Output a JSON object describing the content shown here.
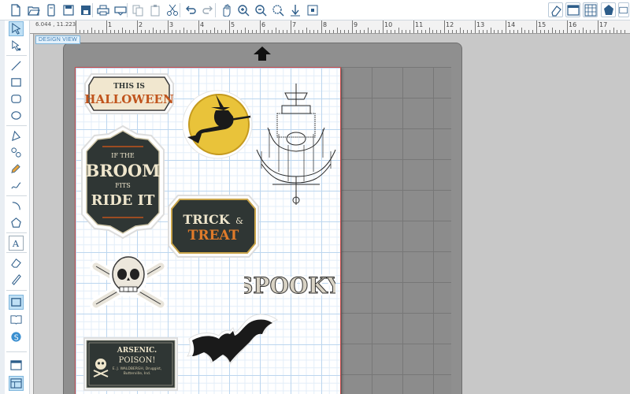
{
  "toolbar": {
    "buttons": [
      {
        "name": "new-document-icon",
        "glyph": "□"
      },
      {
        "name": "open-folder-icon",
        "glyph": "▭"
      },
      {
        "name": "library-icon",
        "glyph": "▯"
      },
      {
        "name": "save-icon",
        "glyph": "▣"
      },
      {
        "name": "save-as-icon",
        "glyph": "▤"
      },
      {
        "name": "print-icon",
        "glyph": "⎙"
      },
      {
        "name": "send-to-cutter-icon",
        "glyph": "⇥"
      },
      {
        "name": "copy-icon",
        "glyph": "❐"
      },
      {
        "name": "paste-icon",
        "glyph": "❏"
      },
      {
        "name": "cut-icon",
        "glyph": "✂"
      },
      {
        "name": "undo-icon",
        "glyph": "↶"
      },
      {
        "name": "redo-icon",
        "glyph": "↷"
      },
      {
        "name": "pan-hand-icon",
        "glyph": "✋"
      },
      {
        "name": "zoom-in-icon",
        "glyph": "⊕"
      },
      {
        "name": "zoom-out-icon",
        "glyph": "⊖"
      },
      {
        "name": "zoom-selected-icon",
        "glyph": "⊙"
      },
      {
        "name": "zoom-drag-icon",
        "glyph": "⇓"
      },
      {
        "name": "fit-to-page-icon",
        "glyph": "⊞"
      }
    ],
    "right_buttons": [
      {
        "name": "eraser-panel-icon",
        "glyph": "◇"
      },
      {
        "name": "page-setup-icon",
        "glyph": "▤"
      },
      {
        "name": "grid-settings-icon",
        "glyph": "▦"
      },
      {
        "name": "store-icon",
        "glyph": "⬟"
      },
      {
        "name": "send-panel-icon",
        "glyph": "⊠"
      }
    ]
  },
  "left_tools": [
    {
      "name": "select-tool-icon",
      "active": true
    },
    {
      "name": "edit-points-tool-icon",
      "active": false
    },
    {
      "name": "line-tool-icon",
      "active": false
    },
    {
      "name": "rectangle-tool-icon",
      "active": false
    },
    {
      "name": "rounded-rectangle-tool-icon",
      "active": false
    },
    {
      "name": "ellipse-tool-icon",
      "active": false
    },
    {
      "name": "polygon-tool-icon",
      "active": false
    },
    {
      "name": "curve-tool-icon",
      "active": false
    },
    {
      "name": "freehand-tool-icon",
      "active": false
    },
    {
      "name": "smooth-freehand-tool-icon",
      "active": false
    },
    {
      "name": "arc-tool-icon",
      "active": false
    },
    {
      "name": "regular-polygon-tool-icon",
      "active": false
    },
    {
      "name": "text-tool-icon",
      "active": false
    },
    {
      "name": "eraser-tool-icon",
      "active": false
    },
    {
      "name": "knife-tool-icon",
      "active": false
    },
    {
      "name": "design-view-icon",
      "active": true
    },
    {
      "name": "library-view-icon",
      "active": false
    },
    {
      "name": "store-view-icon",
      "active": false
    },
    {
      "name": "single-panel-icon",
      "active": false
    },
    {
      "name": "split-panel-icon",
      "active": true
    }
  ],
  "ruler": {
    "numbers": [
      "1",
      "2",
      "3",
      "4",
      "5",
      "6",
      "7",
      "8",
      "9",
      "10",
      "11",
      "12",
      "13",
      "14",
      "15",
      "16",
      "17"
    ]
  },
  "coords": "6.044 , 11.223",
  "design_tab": "DESIGN VIEW",
  "stickers": {
    "halloween": {
      "line1": "THIS IS",
      "line2": "HALLOWEEN"
    },
    "broom": {
      "line1": "IF THE",
      "line2": "BROOM",
      "line3": "FITS",
      "line4": "RIDE IT"
    },
    "trick": {
      "line1": "TRICK",
      "amp": "&",
      "line2": "TREAT"
    },
    "spooky": {
      "text": "SPOOKY"
    },
    "arsenic": {
      "line1": "ARSENIC.",
      "line2": "POISON!",
      "small1": "E. J. WALDBERGH, Druggist,",
      "small2": "Butterville, Ind."
    }
  },
  "colors": {
    "accent": "#2d5d8a",
    "halloween_orange": "#c0541c",
    "badge_dark": "#2f3634",
    "moon": "#e9c33a"
  }
}
